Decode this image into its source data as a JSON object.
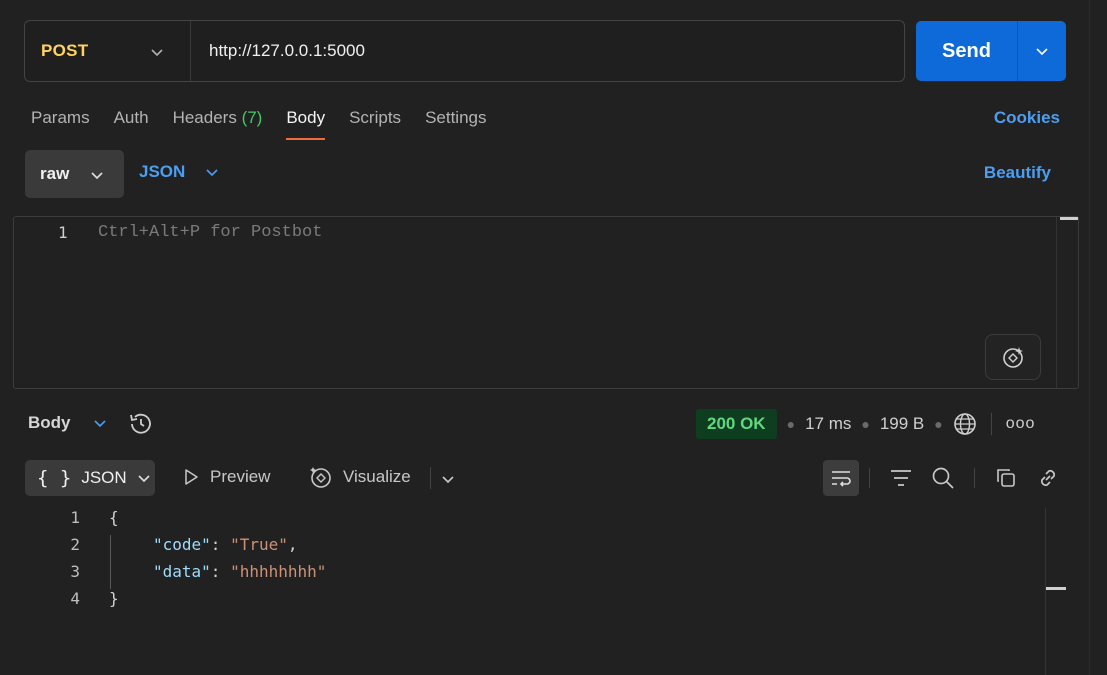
{
  "request": {
    "method": "POST",
    "url": "http://127.0.0.1:5000",
    "send_label": "Send"
  },
  "tabs": {
    "params": "Params",
    "auth": "Auth",
    "headers": "Headers",
    "headers_count": "(7)",
    "body": "Body",
    "scripts": "Scripts",
    "settings": "Settings",
    "active": "Body",
    "cookies": "Cookies"
  },
  "body_mode": {
    "mode": "raw",
    "language": "JSON",
    "beautify": "Beautify"
  },
  "editor": {
    "line_number": "1",
    "placeholder": "Ctrl+Alt+P for Postbot"
  },
  "response": {
    "view_label": "Body",
    "status": "200 OK",
    "time": "17 ms",
    "size": "199 B",
    "more": "ooo",
    "formats": {
      "active": "JSON",
      "braces": "{ }",
      "preview": "Preview",
      "visualize": "Visualize"
    },
    "code": {
      "line_numbers": [
        "1",
        "2",
        "3",
        "4"
      ],
      "open_brace": "{",
      "close_brace": "}",
      "key1": "\"code\"",
      "val1": "\"True\"",
      "key2": "\"data\"",
      "val2": "\"hhhhhhhh\"",
      "colon": ": ",
      "comma": ","
    }
  },
  "colors": {
    "accent": "#0d6ad8",
    "method": "#ffd35c",
    "link": "#4b9ff3",
    "status_ok": "#5fd87f",
    "tab_underline": "#f26b3a"
  },
  "icons": [
    "chevron-down-icon",
    "postbot-icon",
    "history-icon",
    "play-icon",
    "visualize-icon",
    "wrap-icon",
    "filter-icon",
    "search-icon",
    "copy-icon",
    "link-icon",
    "globe-icon"
  ]
}
